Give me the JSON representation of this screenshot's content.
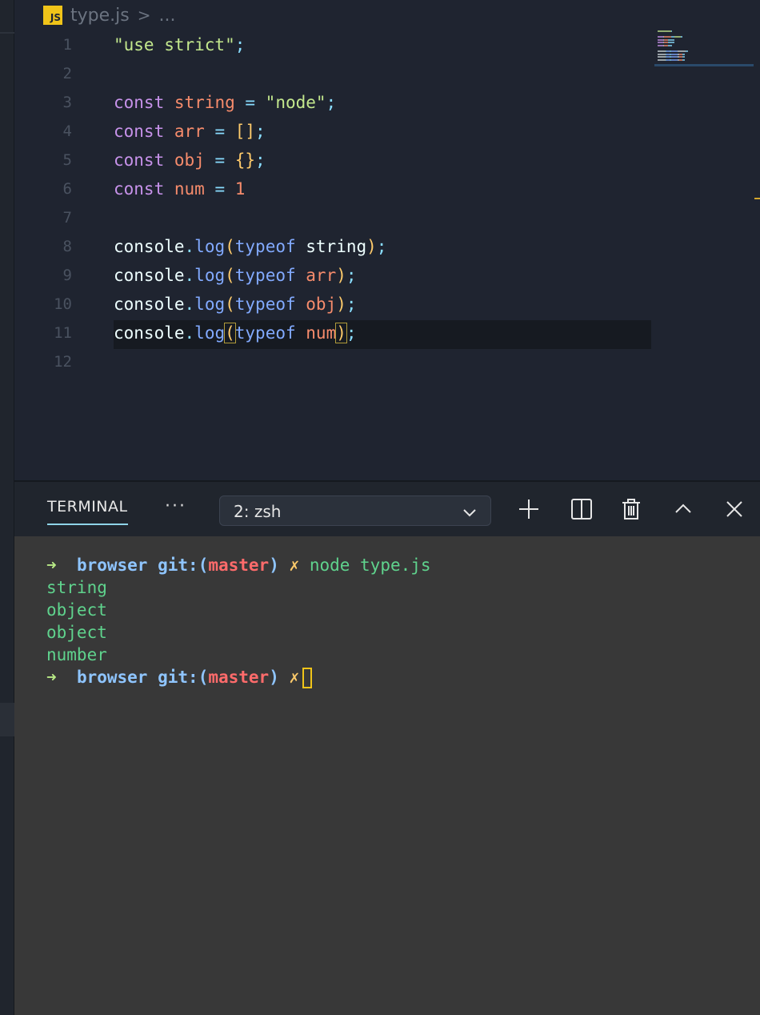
{
  "breadcrumb": {
    "badge": "JS",
    "file": "type.js",
    "separator": ">",
    "more": "..."
  },
  "editor": {
    "lines": [
      {
        "n": "1",
        "tokens": [
          {
            "t": "\"use strict\"",
            "c": "str"
          },
          {
            "t": ";",
            "c": "punct"
          }
        ]
      },
      {
        "n": "2",
        "tokens": []
      },
      {
        "n": "3",
        "tokens": [
          {
            "t": "const",
            "c": "kw"
          },
          {
            "t": " ",
            "c": "plain"
          },
          {
            "t": "string",
            "c": "var"
          },
          {
            "t": " = ",
            "c": "op"
          },
          {
            "t": "\"node\"",
            "c": "str"
          },
          {
            "t": ";",
            "c": "punct"
          }
        ]
      },
      {
        "n": "4",
        "tokens": [
          {
            "t": "const",
            "c": "kw"
          },
          {
            "t": " ",
            "c": "plain"
          },
          {
            "t": "arr",
            "c": "var"
          },
          {
            "t": " = ",
            "c": "op"
          },
          {
            "t": "[]",
            "c": "brk"
          },
          {
            "t": ";",
            "c": "punct"
          }
        ]
      },
      {
        "n": "5",
        "tokens": [
          {
            "t": "const",
            "c": "kw"
          },
          {
            "t": " ",
            "c": "plain"
          },
          {
            "t": "obj",
            "c": "var"
          },
          {
            "t": " = ",
            "c": "op"
          },
          {
            "t": "{}",
            "c": "brk"
          },
          {
            "t": ";",
            "c": "punct"
          }
        ]
      },
      {
        "n": "6",
        "tokens": [
          {
            "t": "const",
            "c": "kw"
          },
          {
            "t": " ",
            "c": "plain"
          },
          {
            "t": "num",
            "c": "var"
          },
          {
            "t": " = ",
            "c": "op"
          },
          {
            "t": "1",
            "c": "num"
          }
        ]
      },
      {
        "n": "7",
        "tokens": []
      },
      {
        "n": "8",
        "tokens": [
          {
            "t": "console",
            "c": "plain"
          },
          {
            "t": ".",
            "c": "punct"
          },
          {
            "t": "log",
            "c": "fn"
          },
          {
            "t": "(",
            "c": "brk"
          },
          {
            "t": "typeof",
            "c": "typeof"
          },
          {
            "t": " string",
            "c": "plain"
          },
          {
            "t": ")",
            "c": "brk"
          },
          {
            "t": ";",
            "c": "punct"
          }
        ]
      },
      {
        "n": "9",
        "tokens": [
          {
            "t": "console",
            "c": "plain"
          },
          {
            "t": ".",
            "c": "punct"
          },
          {
            "t": "log",
            "c": "fn"
          },
          {
            "t": "(",
            "c": "brk"
          },
          {
            "t": "typeof",
            "c": "typeof"
          },
          {
            "t": " ",
            "c": "plain"
          },
          {
            "t": "arr",
            "c": "var"
          },
          {
            "t": ")",
            "c": "brk"
          },
          {
            "t": ";",
            "c": "punct"
          }
        ]
      },
      {
        "n": "10",
        "tokens": [
          {
            "t": "console",
            "c": "plain"
          },
          {
            "t": ".",
            "c": "punct"
          },
          {
            "t": "log",
            "c": "fn"
          },
          {
            "t": "(",
            "c": "brk"
          },
          {
            "t": "typeof",
            "c": "typeof"
          },
          {
            "t": " ",
            "c": "plain"
          },
          {
            "t": "obj",
            "c": "var"
          },
          {
            "t": ")",
            "c": "brk"
          },
          {
            "t": ";",
            "c": "punct"
          }
        ]
      },
      {
        "n": "11",
        "tokens": [
          {
            "t": "console",
            "c": "plain"
          },
          {
            "t": ".",
            "c": "punct"
          },
          {
            "t": "log",
            "c": "fn"
          },
          {
            "t": "(",
            "c": "brk match"
          },
          {
            "t": "typeof",
            "c": "typeof"
          },
          {
            "t": " ",
            "c": "plain"
          },
          {
            "t": "num",
            "c": "var"
          },
          {
            "t": ")",
            "c": "brk match"
          },
          {
            "t": ";",
            "c": "punct"
          }
        ]
      },
      {
        "n": "12",
        "tokens": []
      }
    ]
  },
  "panel": {
    "tab_label": "TERMINAL",
    "more_label": "···",
    "shell_selected": "2: zsh"
  },
  "terminal": {
    "prompt_arrow": "➜",
    "dir": "browser",
    "git_prefix": "git:(",
    "branch": "master",
    "git_suffix": ")",
    "dirty": "✗",
    "command": "node type.js",
    "outputs": [
      "string",
      "object",
      "object",
      "number"
    ]
  },
  "colors": {
    "editor_bg": "#1f2430",
    "terminal_bg": "#383838",
    "accent": "#8fd4e8",
    "js_badge": "#f0c419"
  },
  "icons": [
    "chevron-down-icon",
    "plus-icon",
    "split-icon",
    "trash-icon",
    "chevron-up-icon",
    "close-icon"
  ]
}
